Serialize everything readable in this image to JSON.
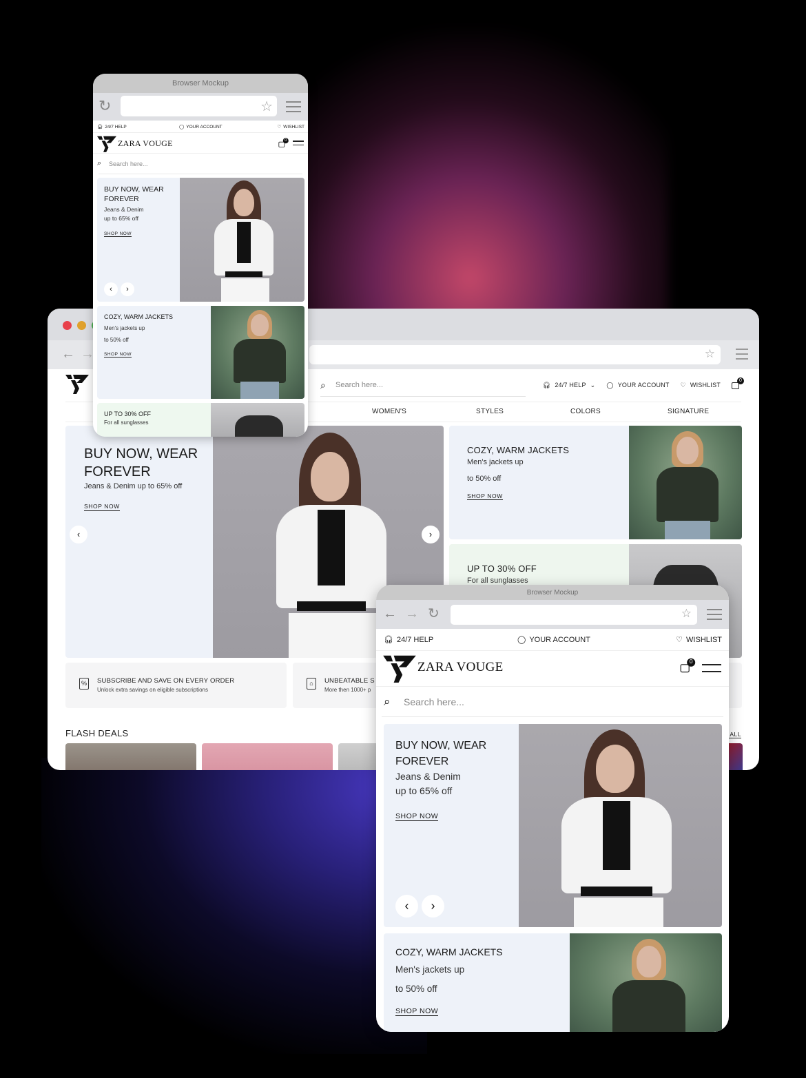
{
  "background": {
    "glow_top_color": "#cd4b6e",
    "glow_bottom_color": "#4637be"
  },
  "brand": {
    "name": "ZARA VOUGE",
    "cart_count": "0"
  },
  "mockup_title": "Browser Mockup",
  "top_links": {
    "help": "24/7 HELP",
    "account": "YOUR ACCOUNT",
    "wishlist": "WISHLIST"
  },
  "search": {
    "placeholder": "Search here..."
  },
  "icons": {
    "back": "←",
    "forward": "→",
    "refresh": "↻",
    "star": "☆",
    "search": "⌕",
    "prev": "‹",
    "next": "›",
    "chevron_down": "⌄"
  },
  "desktop": {
    "nav": [
      "WOMEN'S",
      "STYLES",
      "COLORS",
      "SIGNATURE"
    ],
    "hero": {
      "title": "BUY NOW, WEAR FOREVER",
      "subtitle": "Jeans & Denim up to 65% off",
      "cta": "SHOP NOW"
    },
    "promos": [
      {
        "title": "COZY, WARM JACKETS",
        "line1": "Men's jackets up",
        "line2": "to 50% off",
        "cta": "SHOP NOW"
      },
      {
        "title": "UP TO 30% OFF",
        "line1": "For all sunglasses"
      }
    ],
    "features": [
      {
        "title": "SUBSCRIBE AND SAVE ON EVERY ORDER",
        "subtitle": "Unlock extra savings on eligible subscriptions"
      },
      {
        "title": "UNBEATABLE S",
        "subtitle": "More then 1000+ p"
      }
    ],
    "flash_deals": {
      "title": "FLASH DEALS",
      "view_all": "VIEW ALL"
    }
  },
  "mobile": {
    "hero": {
      "title": "BUY NOW, WEAR FOREVER",
      "line1": "Jeans & Denim",
      "line2": "up to 65% off",
      "cta": "SHOP NOW"
    },
    "promos": [
      {
        "title": "COZY, WARM JACKETS",
        "line1": "Men's jackets up",
        "line2": "to 50% off",
        "cta": "SHOP NOW"
      },
      {
        "title": "UP TO 30% OFF",
        "line1": "For all sunglasses"
      }
    ]
  }
}
